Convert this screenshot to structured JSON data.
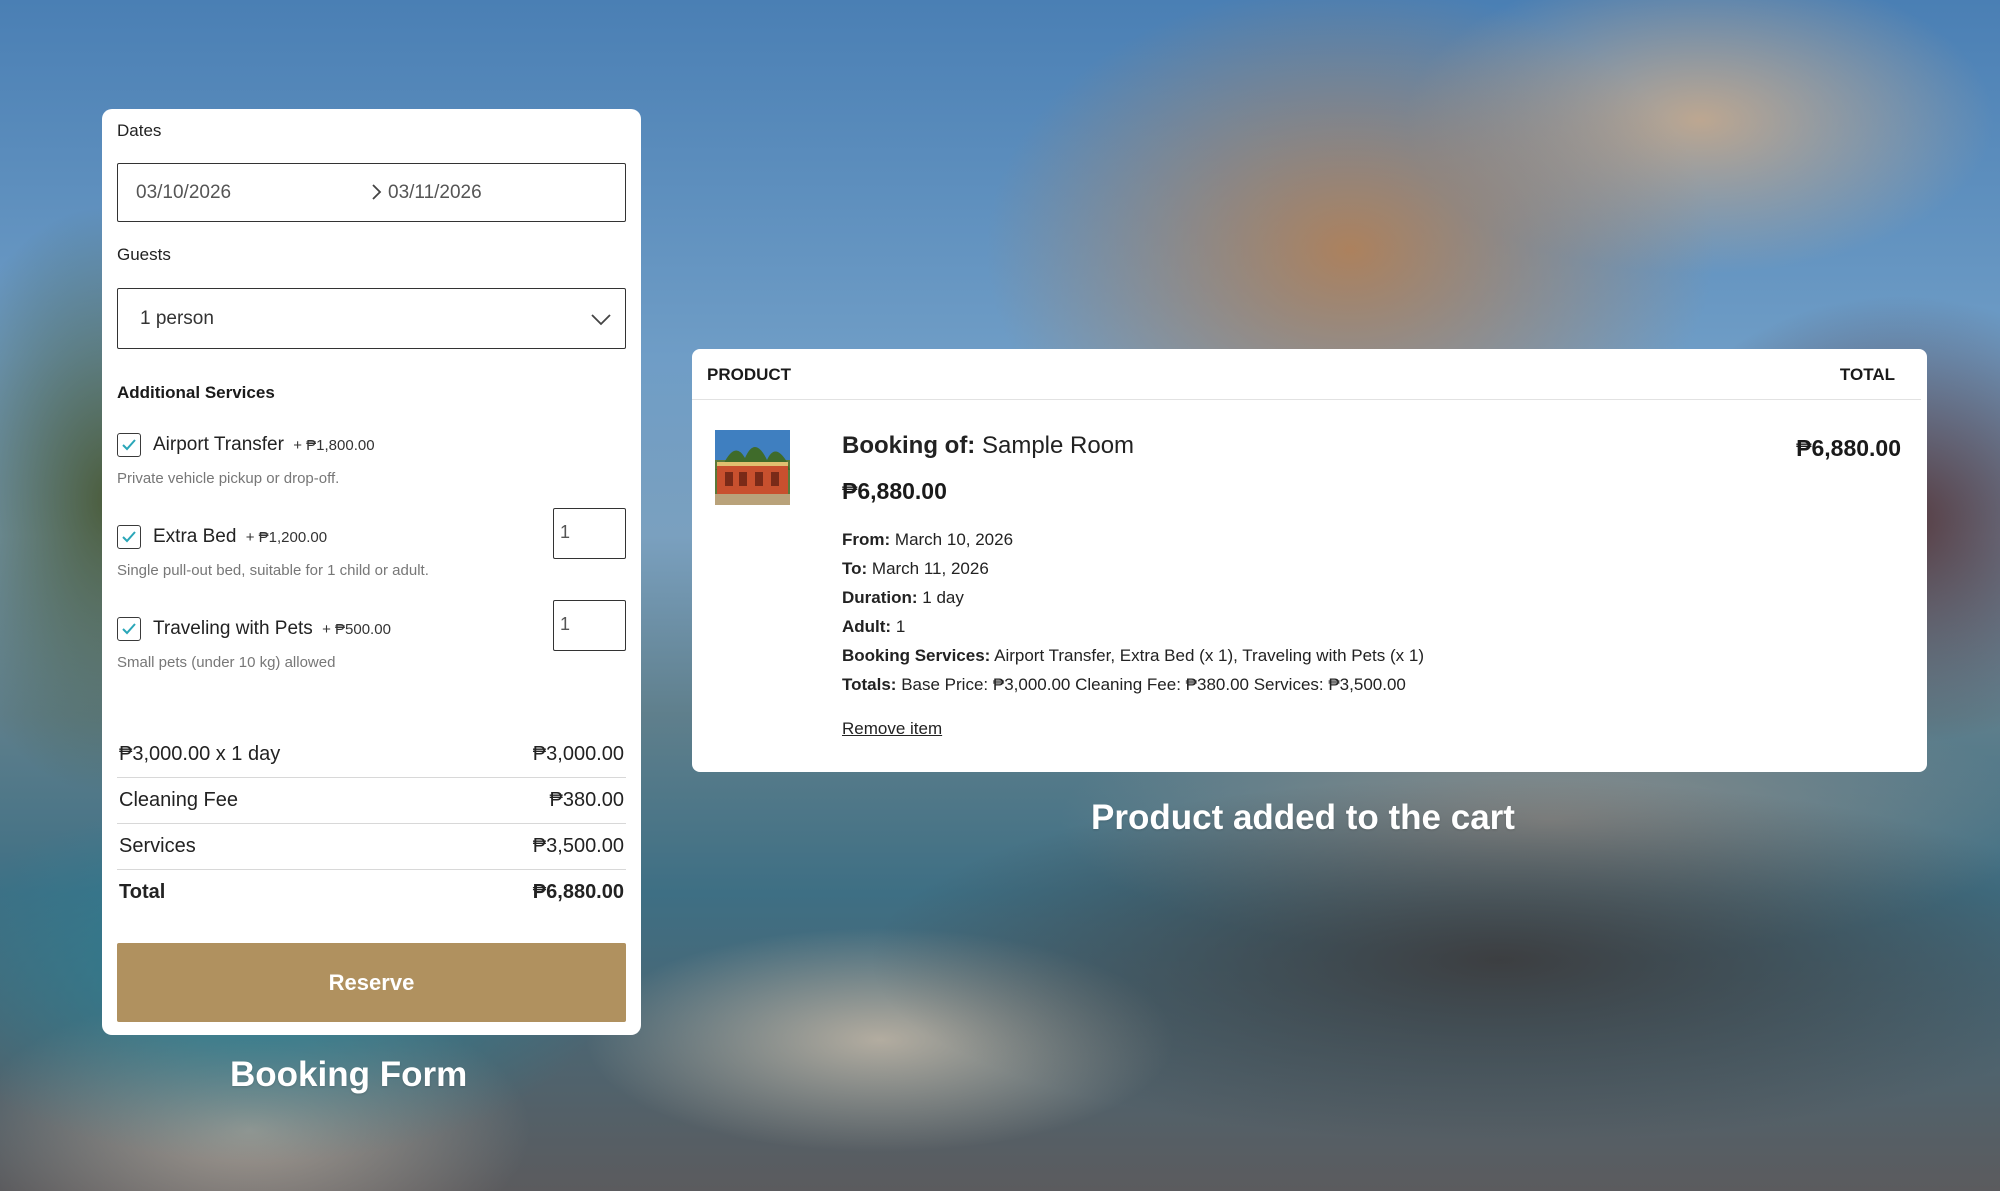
{
  "booking_form": {
    "dates_label": "Dates",
    "check_in": "03/10/2026",
    "check_out": "03/11/2026",
    "guests_label": "Guests",
    "guests_value": "1 person",
    "services_title": "Additional Services",
    "services": [
      {
        "name": "Airport Transfer",
        "price": "+ ₱1,800.00",
        "description": "Private vehicle pickup or drop-off.",
        "checked": true
      },
      {
        "name": "Extra Bed",
        "price": "+ ₱1,200.00",
        "description": "Single pull-out bed, suitable for 1 child or adult.",
        "checked": true,
        "quantity": "1"
      },
      {
        "name": "Traveling with Pets",
        "price": "+ ₱500.00",
        "description": "Small pets (under 10 kg) allowed",
        "checked": true,
        "quantity": "1"
      }
    ],
    "summary": [
      {
        "label": "₱3,000.00 x 1 day",
        "value": "₱3,000.00"
      },
      {
        "label": "Cleaning Fee",
        "value": "₱380.00"
      },
      {
        "label": "Services",
        "value": "₱3,500.00"
      },
      {
        "label": "Total",
        "value": "₱6,880.00"
      }
    ],
    "reserve_label": "Reserve",
    "caption": "Booking Form"
  },
  "cart": {
    "col_product": "PRODUCT",
    "col_total": "TOTAL",
    "item": {
      "title_prefix": "Booking of:",
      "title": "Sample Room",
      "price": "₱6,880.00",
      "line_total": "₱6,880.00",
      "details": [
        {
          "key": "From:",
          "value": "March 10, 2026"
        },
        {
          "key": "To:",
          "value": "March 11, 2026"
        },
        {
          "key": "Duration:",
          "value": "1 day"
        },
        {
          "key": "Adult:",
          "value": "1"
        },
        {
          "key": "Booking Services:",
          "value": "Airport Transfer, Extra Bed (x 1), Traveling with Pets (x 1)"
        },
        {
          "key": "Totals:",
          "value": "Base Price: ₱3,000.00 Cleaning Fee: ₱380.00 Services: ₱3,500.00"
        }
      ],
      "remove_label": "Remove item"
    },
    "caption": "Product added to the cart"
  },
  "colors": {
    "reserve_button": "#b0915f",
    "checkbox_check": "#2aa6b8"
  },
  "icons": {
    "date_separator": "chevron-right-icon",
    "select_arrow": "chevron-down-icon",
    "checkbox": "checkmark-icon"
  }
}
